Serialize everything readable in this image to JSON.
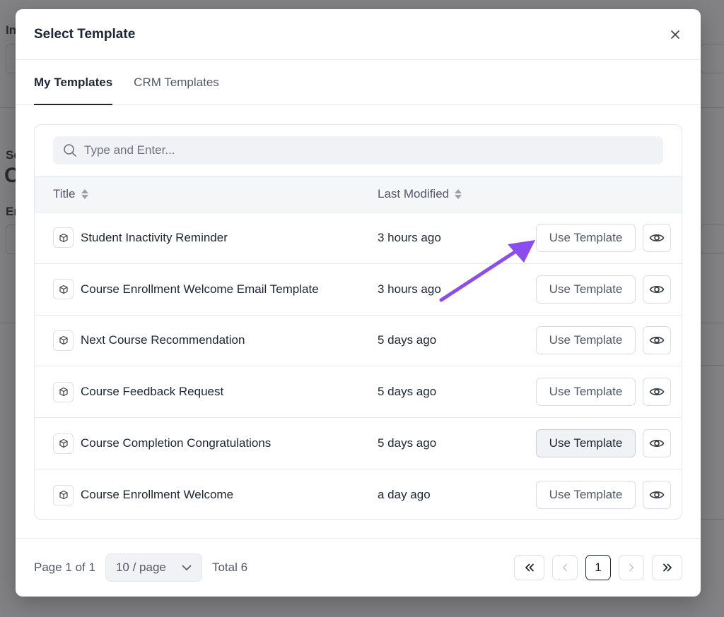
{
  "background": {
    "fragments": [
      "In",
      "Se",
      "C",
      "Er"
    ]
  },
  "modal": {
    "title": "Select Template",
    "tabs": [
      {
        "label": "My Templates",
        "active": true
      },
      {
        "label": "CRM Templates",
        "active": false
      }
    ],
    "search": {
      "placeholder": "Type and Enter...",
      "value": ""
    },
    "columns": {
      "title": "Title",
      "last_modified": "Last Modified"
    },
    "rows": [
      {
        "title": "Student Inactivity Reminder",
        "modified": "3 hours ago",
        "action": "Use Template"
      },
      {
        "title": "Course Enrollment Welcome Email Template",
        "modified": "3 hours ago",
        "action": "Use Template"
      },
      {
        "title": "Next Course Recommendation",
        "modified": "5 days ago",
        "action": "Use Template"
      },
      {
        "title": "Course Feedback Request",
        "modified": "5 days ago",
        "action": "Use Template"
      },
      {
        "title": "Course Completion Congratulations",
        "modified": "5 days ago",
        "action": "Use Template"
      },
      {
        "title": "Course Enrollment Welcome",
        "modified": "a day ago",
        "action": "Use Template"
      }
    ],
    "footer": {
      "page_info": "Page 1 of 1",
      "per_page": "10 / page",
      "total": "Total 6",
      "current_page": "1"
    }
  },
  "icons": {
    "close": "close-icon",
    "search": "search-icon",
    "sort": "sort-icon",
    "template": "cube-icon",
    "preview": "eye-icon",
    "first": "double-chevron-left-icon",
    "prev": "chevron-left-icon",
    "next": "chevron-right-icon",
    "last": "double-chevron-right-icon",
    "dropdown": "chevron-down-icon"
  },
  "colors": {
    "accent_arrow": "#8b4cf0",
    "text_primary": "#1d2433",
    "text_secondary": "#525866"
  }
}
